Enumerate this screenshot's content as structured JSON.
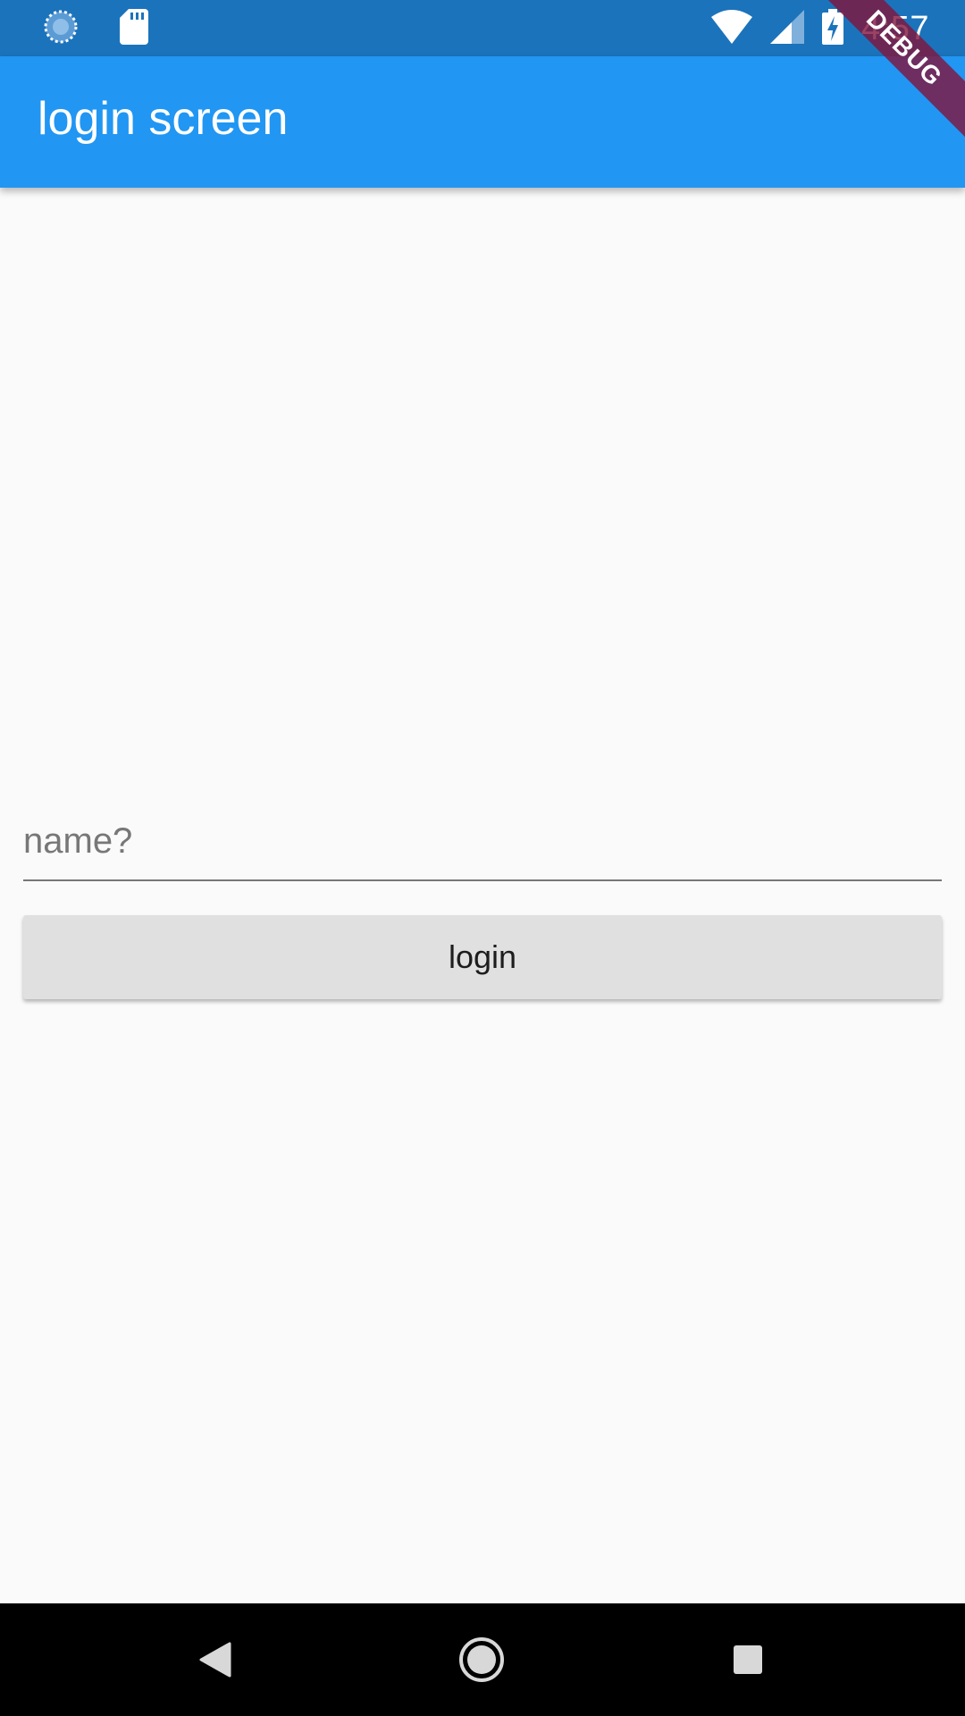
{
  "status_bar": {
    "time": "4:57",
    "icons": [
      "sync-icon",
      "sd-card-icon",
      "wifi-icon",
      "cell-signal-icon",
      "battery-charging-icon"
    ],
    "background": "#1b73bb"
  },
  "app_bar": {
    "title": "login screen",
    "background": "#2196f3"
  },
  "debug_banner": {
    "label": "DEBUG"
  },
  "form": {
    "name_placeholder": "name?",
    "name_value": "",
    "login_label": "login"
  },
  "nav_bar": {
    "buttons": [
      "back-icon",
      "home-icon",
      "recents-icon"
    ]
  }
}
